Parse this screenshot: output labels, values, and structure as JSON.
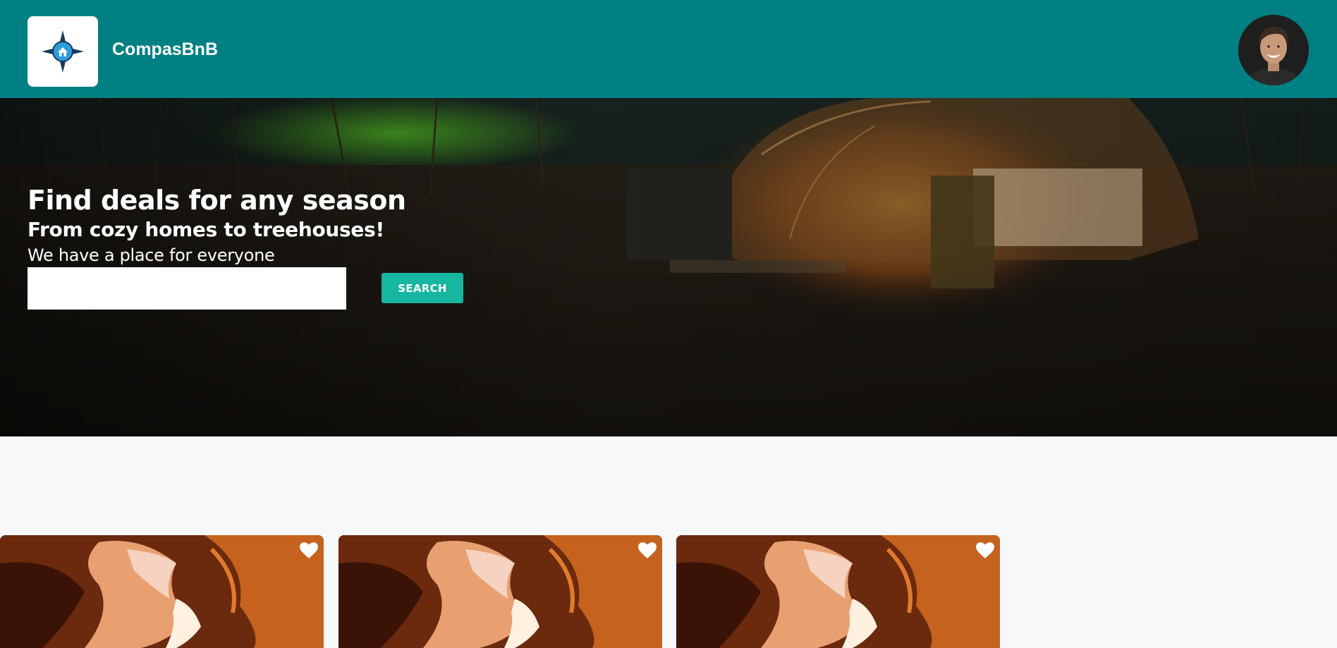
{
  "header": {
    "brand": "CompasBnB",
    "logo_icon": "compass-house-icon",
    "avatar_icon": "user-avatar"
  },
  "hero": {
    "title": "Find deals for any season",
    "subtitle": "From cozy homes to treehouses!",
    "tagline": "We have a place for everyone",
    "search_value": "",
    "search_button": "SEARCH"
  },
  "listings": [
    {
      "image": "canyon-photo",
      "favorite_icon": "heart-icon"
    },
    {
      "image": "canyon-photo",
      "favorite_icon": "heart-icon"
    },
    {
      "image": "canyon-photo",
      "favorite_icon": "heart-icon"
    }
  ],
  "colors": {
    "header_bg": "#008082",
    "search_button_bg": "#16b6a0",
    "page_bg": "#f7f8fa"
  }
}
